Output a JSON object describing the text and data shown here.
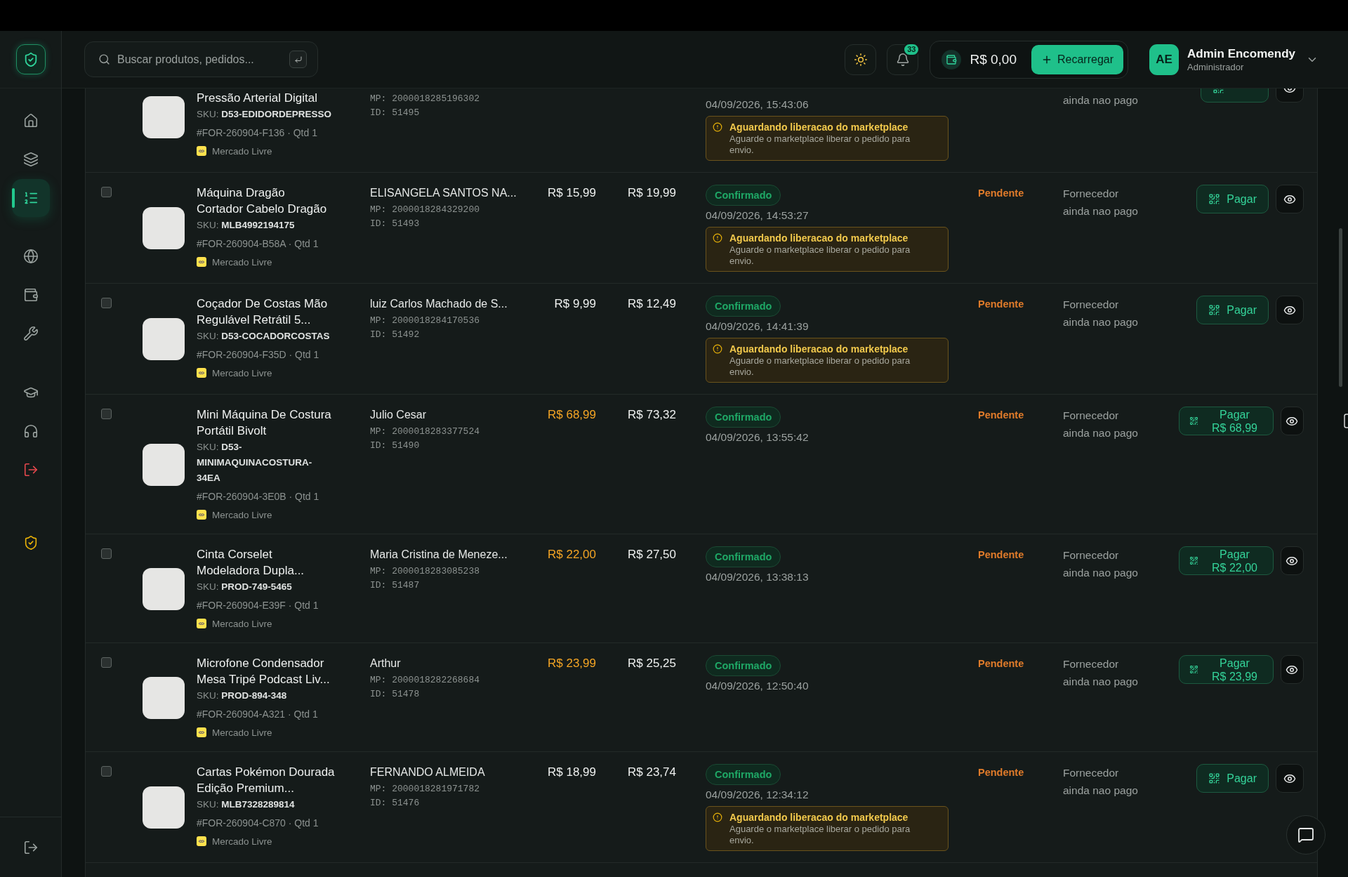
{
  "sidebar": {
    "items": [
      {
        "selected": false
      },
      {
        "selected": false
      },
      {
        "selected": true
      },
      {
        "selected": false
      },
      {
        "selected": false
      },
      {
        "selected": false
      },
      {
        "selected": false
      },
      {
        "selected": false
      },
      {
        "selected": false
      },
      {
        "selected": false
      }
    ]
  },
  "header": {
    "search": {
      "placeholder": "Buscar produtos, pedidos..."
    },
    "notifications": "33",
    "balance": "R$ 0,00",
    "recharge_button": "Recarregar",
    "user": {
      "initials": "AE",
      "name": "Admin Encomendy",
      "role": "Administrador"
    }
  },
  "orders": [
    {
      "product": {
        "title": "Pressão Arterial Digital",
        "sku": "SKU: **D53-EDIDORDEPRESSO**",
        "order": "#FOR-260904-F136 · Qtd 1",
        "marketplace": "Mercado Livre"
      },
      "customer": {
        "mp": "MP: 2000018285196302",
        "id": "ID: 51495"
      },
      "status": {
        "date": "04/09/2026, 15:43:06",
        "warning": {
          "title": "Aguardando liberacao do marketplace",
          "text": "Aguarde o marketplace liberar o pedido para envio."
        }
      },
      "supplier": "ainda nao pago",
      "pay_button": true
    },
    {
      "checked": false,
      "product": {
        "title": "Máquina Dragão\nCortador Cabelo Dragão",
        "sku": "SKU: **MLB4992194175**",
        "order": "#FOR-260904-B58A · Qtd 1",
        "marketplace": "Mercado Livre"
      },
      "customer": {
        "name": "ELISANGELA SANTOS NA...",
        "mp": "MP: 2000018284329200",
        "id": "ID: 51493"
      },
      "sale_price": {
        "text": "R$ 15,99",
        "highlighted": false
      },
      "cost_price": "R$ 19,99",
      "status": {
        "label": "Confirmado",
        "date": "04/09/2026, 14:53:27",
        "warning": {
          "title": "Aguardando liberacao do marketplace",
          "text": "Aguarde o marketplace liberar o pedido para envio."
        }
      },
      "payment_status": "Pendente",
      "supplier": "Fornecedor ainda nao pago",
      "pay_button": {
        "label": "Pagar"
      }
    },
    {
      "checked": false,
      "product": {
        "title": "Coçador De Costas Mão\nRegulável Retrátil 5...",
        "sku": "SKU: **D53-COCADORCOSTAS**",
        "order": "#FOR-260904-F35D · Qtd 1",
        "marketplace": "Mercado Livre"
      },
      "customer": {
        "name": "luiz Carlos Machado de S...",
        "mp": "MP: 2000018284170536",
        "id": "ID: 51492"
      },
      "sale_price": {
        "text": "R$ 9,99",
        "highlighted": false
      },
      "cost_price": "R$ 12,49",
      "status": {
        "label": "Confirmado",
        "date": "04/09/2026, 14:41:39",
        "warning": {
          "title": "Aguardando liberacao do marketplace",
          "text": "Aguarde o marketplace liberar o pedido para envio."
        }
      },
      "payment_status": "Pendente",
      "supplier": "Fornecedor ainda nao pago",
      "pay_button": {
        "label": "Pagar"
      }
    },
    {
      "checked": false,
      "product": {
        "title": "Mini Máquina De Costura\nPortátil Bivolt",
        "sku": "SKU: **D53-MINIMAQUINACOSTURA-34EA**",
        "order": "#FOR-260904-3E0B · Qtd 1",
        "marketplace": "Mercado Livre"
      },
      "customer": {
        "name": "Julio Cesar",
        "mp": "MP: 2000018283377524",
        "id": "ID: 51490"
      },
      "sale_price": {
        "text": "R$ 68,99",
        "highlighted": true
      },
      "cost_price": "R$ 73,32",
      "status": {
        "label": "Confirmado",
        "date": "04/09/2026, 13:55:42"
      },
      "payment_status": "Pendente",
      "supplier": "Fornecedor ainda nao pago",
      "pay_button": {
        "label": "Pagar",
        "amount": "R$ 68,99"
      }
    },
    {
      "checked": false,
      "product": {
        "title": "Cinta Corselet\nModeladora Dupla...",
        "sku": "SKU: **PROD-749-5465**",
        "order": "#FOR-260904-E39F · Qtd 1",
        "marketplace": "Mercado Livre"
      },
      "customer": {
        "name": "Maria Cristina de Meneze...",
        "mp": "MP: 2000018283085238",
        "id": "ID: 51487"
      },
      "sale_price": {
        "text": "R$ 22,00",
        "highlighted": true
      },
      "cost_price": "R$ 27,50",
      "status": {
        "label": "Confirmado",
        "date": "04/09/2026, 13:38:13"
      },
      "payment_status": "Pendente",
      "supplier": "Fornecedor ainda nao pago",
      "pay_button": {
        "label": "Pagar",
        "amount": "R$ 22,00"
      }
    },
    {
      "checked": false,
      "product": {
        "title": "Microfone Condensador\nMesa Tripé Podcast Liv...",
        "sku": "SKU: **PROD-894-348**",
        "order": "#FOR-260904-A321 · Qtd 1",
        "marketplace": "Mercado Livre"
      },
      "customer": {
        "name": "Arthur",
        "mp": "MP: 2000018282268684",
        "id": "ID: 51478"
      },
      "sale_price": {
        "text": "R$ 23,99",
        "highlighted": true
      },
      "cost_price": "R$ 25,25",
      "status": {
        "label": "Confirmado",
        "date": "04/09/2026, 12:50:40"
      },
      "payment_status": "Pendente",
      "supplier": "Fornecedor ainda nao pago",
      "pay_button": {
        "label": "Pagar",
        "amount": "R$ 23,99"
      }
    },
    {
      "checked": false,
      "product": {
        "title": "Cartas Pokémon Dourada\nEdição Premium...",
        "sku": "SKU: **MLB7328289814**",
        "order": "#FOR-260904-C870 · Qtd 1",
        "marketplace": "Mercado Livre"
      },
      "customer": {
        "name": "FERNANDO ALMEIDA",
        "mp": "MP: 2000018281971782",
        "id": "ID: 51476"
      },
      "sale_price": {
        "text": "R$ 18,99",
        "highlighted": false
      },
      "cost_price": "R$ 23,74",
      "status": {
        "label": "Confirmado",
        "date": "04/09/2026, 12:34:12",
        "warning": {
          "title": "Aguardando liberacao do marketplace",
          "text": "Aguarde o marketplace liberar o pedido para envio."
        }
      },
      "payment_status": "Pendente",
      "supplier": "Fornecedor ainda nao pago",
      "pay_button": {
        "label": "Pagar"
      }
    }
  ]
}
